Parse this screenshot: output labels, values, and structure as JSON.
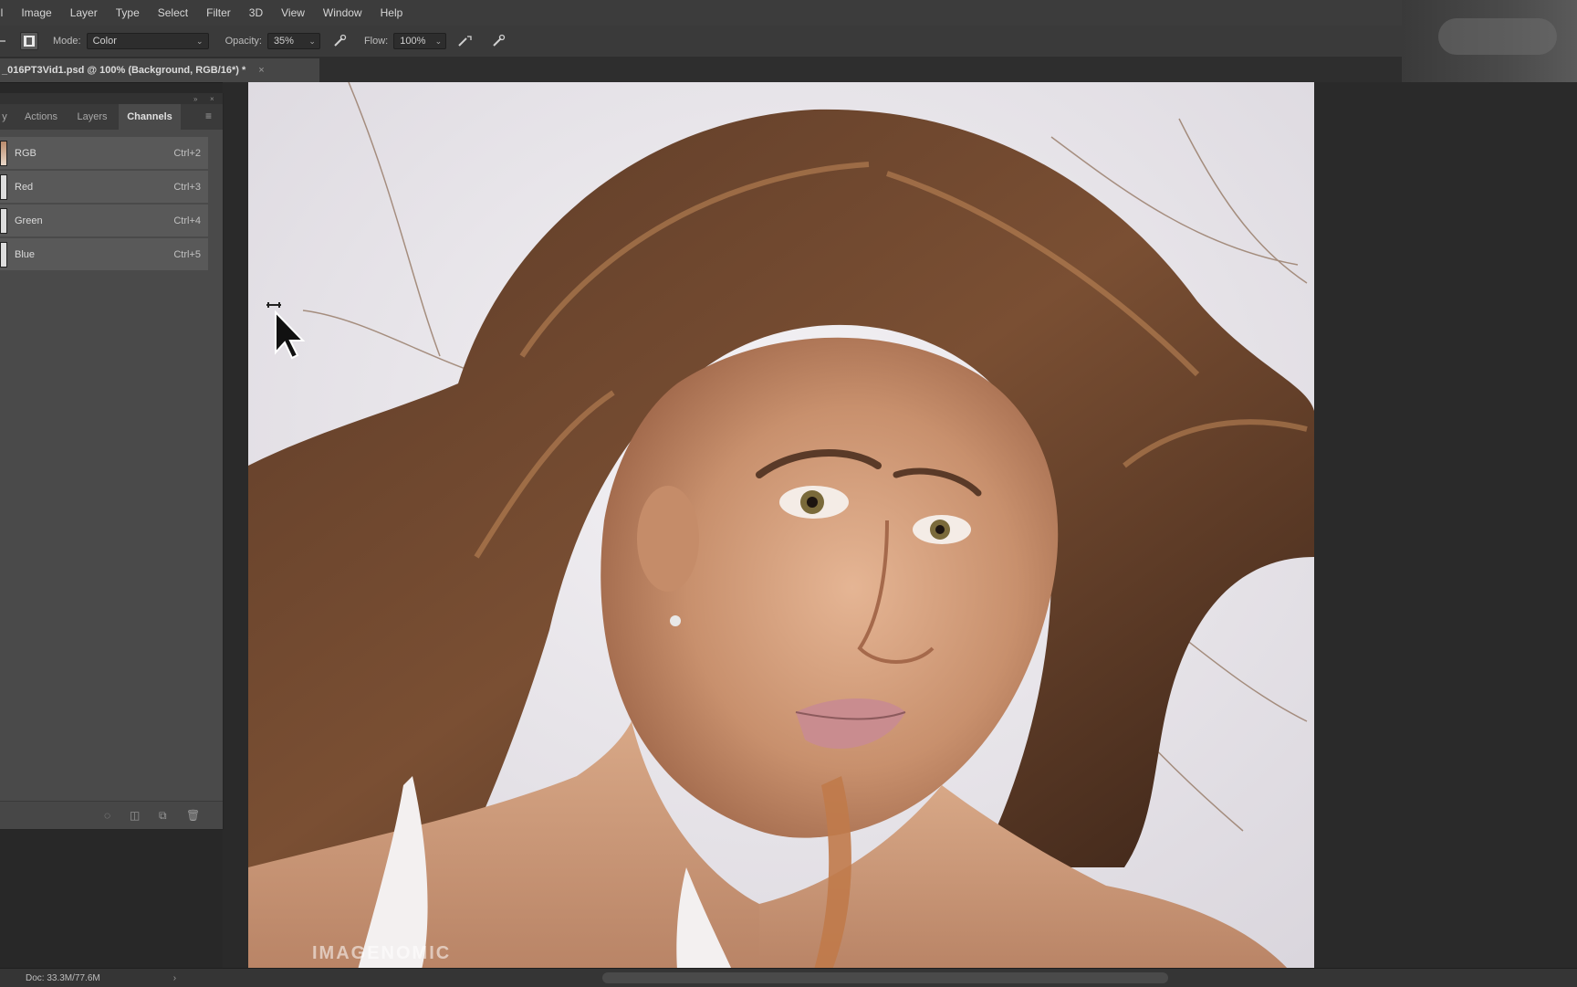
{
  "menu": [
    "ll",
    "Image",
    "Layer",
    "Type",
    "Select",
    "Filter",
    "3D",
    "View",
    "Window",
    "Help"
  ],
  "options": {
    "tool_icon": "brush-preset-icon",
    "mode_label": "Mode:",
    "mode_value": "Color",
    "opacity_label": "Opacity:",
    "opacity_value": "35%",
    "flow_label": "Flow:",
    "flow_value": "100%"
  },
  "document_tab": {
    "title": "_016PT3Vid1.psd @ 100% (Background, RGB/16*) *",
    "close": "×"
  },
  "panel": {
    "tabs": [
      "y",
      "Actions",
      "Layers",
      "Channels"
    ],
    "active_tab": "Channels",
    "channels": [
      {
        "name": "RGB",
        "shortcut": "Ctrl+2"
      },
      {
        "name": "Red",
        "shortcut": "Ctrl+3"
      },
      {
        "name": "Green",
        "shortcut": "Ctrl+4"
      },
      {
        "name": "Blue",
        "shortcut": "Ctrl+5"
      }
    ]
  },
  "watermark": "IMAGENOMIC",
  "status": {
    "doc": "Doc: 33.3M/77.6M",
    "arrow": "›"
  },
  "colors": {
    "menubar": "#3c3c3c",
    "panel": "#4a4a4a",
    "canvas": "#2a2a2a",
    "photo_bg": "#e9e6ea"
  }
}
